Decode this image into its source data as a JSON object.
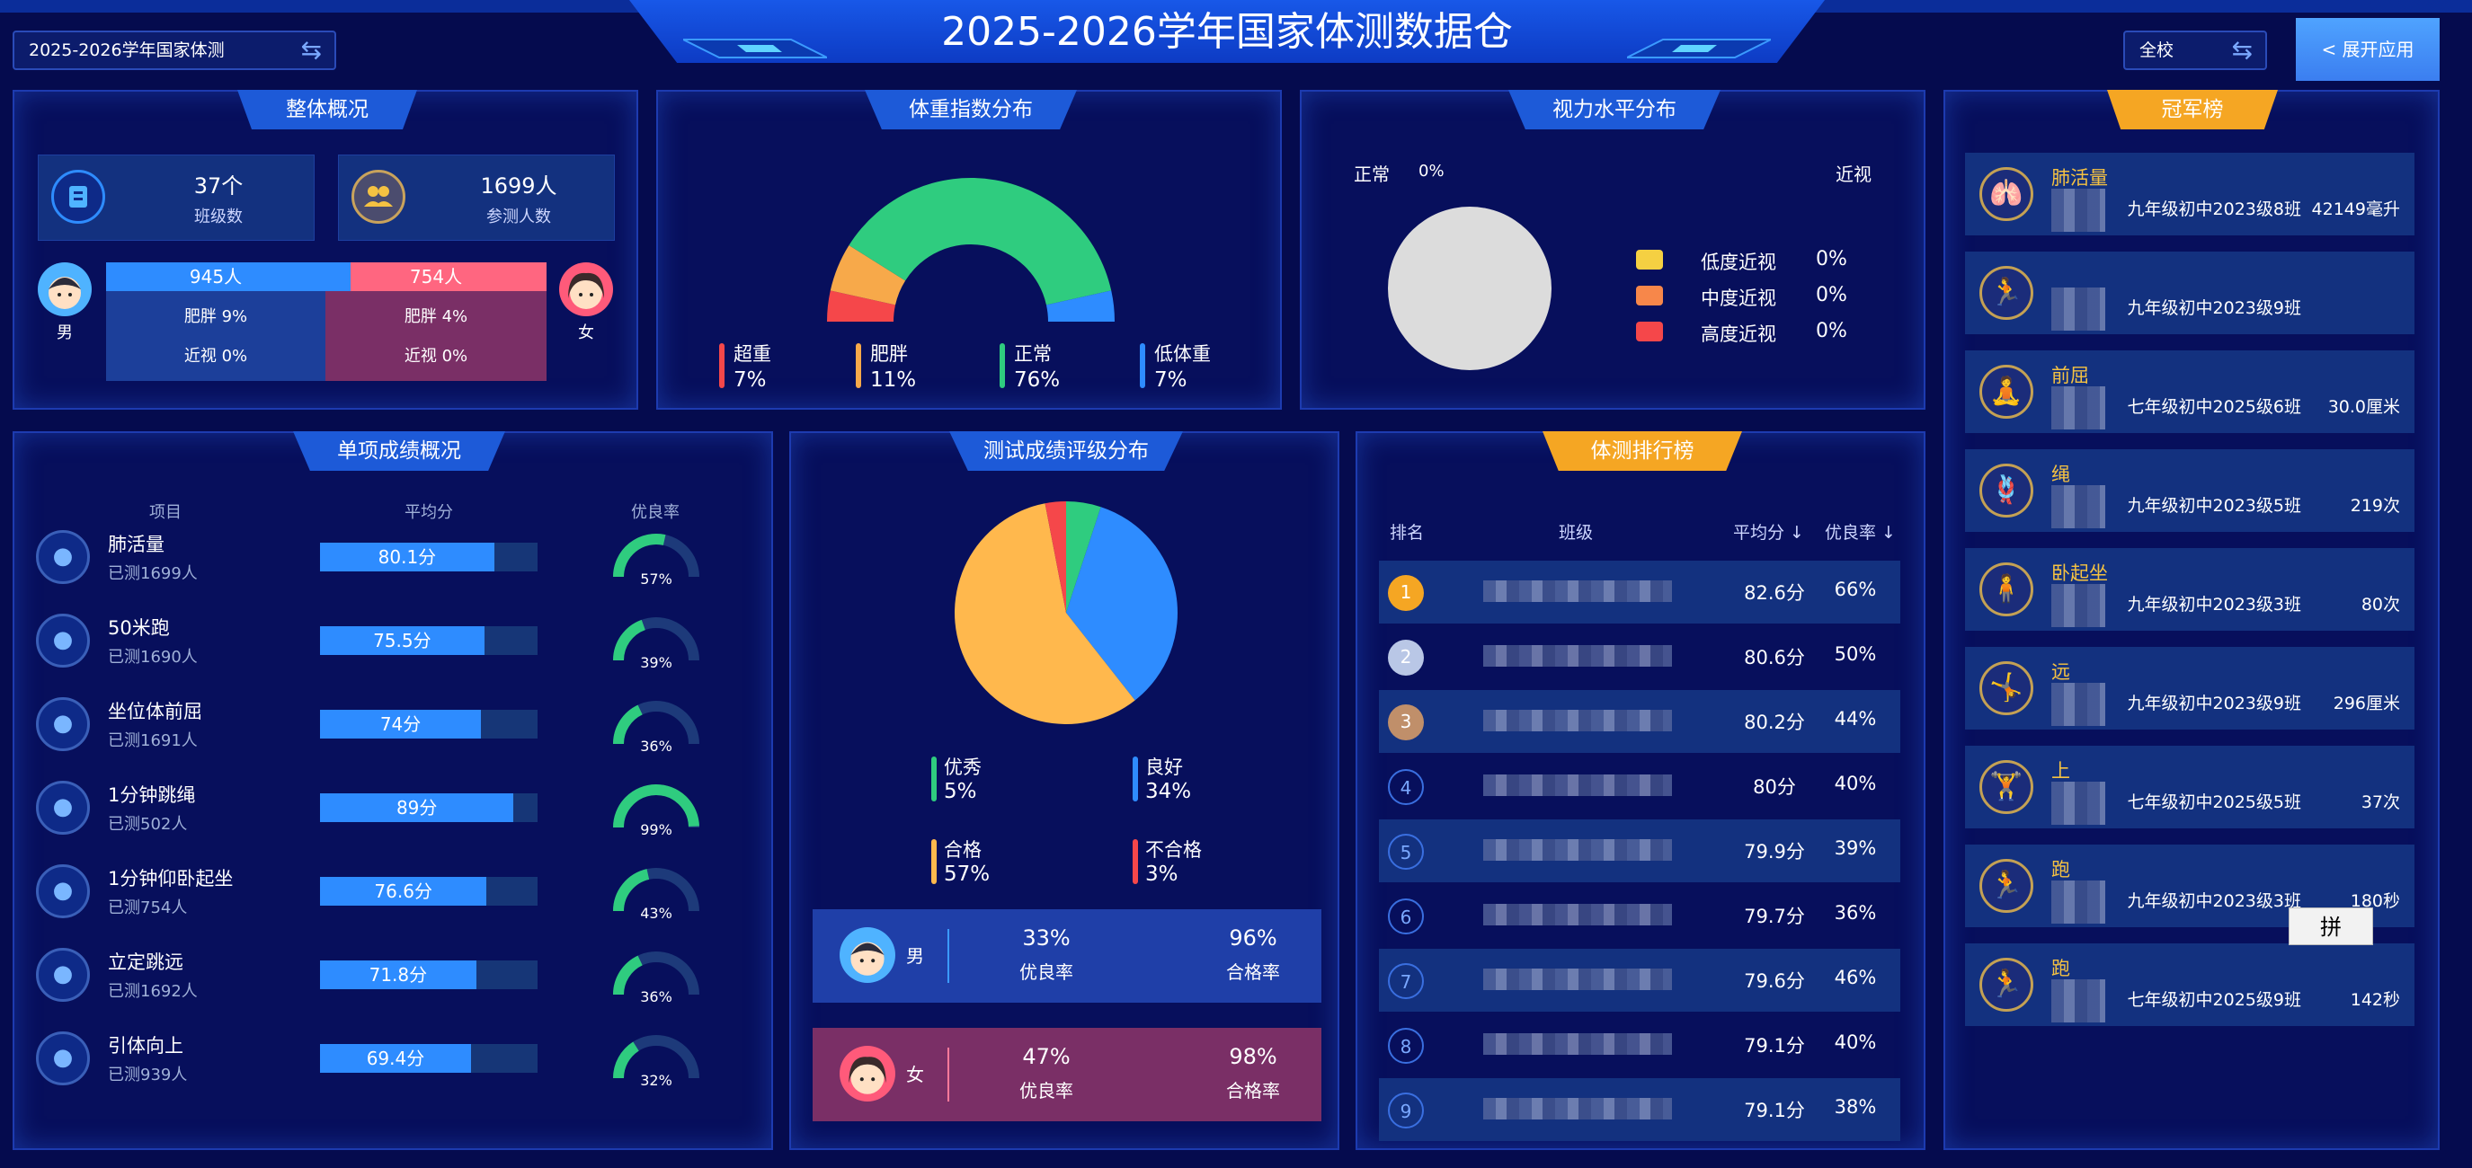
{
  "header": {
    "title": "2025-2026学年国家体测数据仓",
    "left_select": "2025-2026学年国家体测",
    "right_select": "全校",
    "expand_button": "< 展开应用"
  },
  "overview": {
    "title": "整体概况",
    "class_count": "37个",
    "class_count_label": "班级数",
    "participants": "1699人",
    "participants_label": "参测人数",
    "male": {
      "label": "男",
      "count": "945人",
      "obese": "肥胖 9%",
      "myopia": "近视 0%"
    },
    "female": {
      "label": "女",
      "count": "754人",
      "obese": "肥胖 4%",
      "myopia": "近视 0%"
    },
    "male_share": 0.556
  },
  "bmi": {
    "title": "体重指数分布",
    "items": [
      {
        "name": "超重",
        "pct": "7%",
        "color": "#f5474a",
        "value": 7
      },
      {
        "name": "肥胖",
        "pct": "11%",
        "color": "#f7a94a",
        "value": 11
      },
      {
        "name": "正常",
        "pct": "76%",
        "color": "#2fcc7f",
        "value": 76
      },
      {
        "name": "低体重",
        "pct": "7%",
        "color": "#2e8cff",
        "value": 7
      }
    ]
  },
  "vision": {
    "title": "视力水平分布",
    "normal_label": "正常",
    "normal_pct": "0%",
    "myopia_label": "近视",
    "items": [
      {
        "name": "低度近视",
        "pct": "0%",
        "color": "#f5d042"
      },
      {
        "name": "中度近视",
        "pct": "0%",
        "color": "#f7874a"
      },
      {
        "name": "高度近视",
        "pct": "0%",
        "color": "#f5474a"
      }
    ]
  },
  "champions": {
    "title": "冠军榜",
    "items": [
      {
        "name": "肺活量",
        "cls": "九年级初中2023级8班",
        "val": "42149毫升",
        "icon": "lungs-icon",
        "glyph": "🫁"
      },
      {
        "name": "",
        "cls": "九年级初中2023级9班",
        "val": "",
        "icon": "runner-icon",
        "glyph": "🏃"
      },
      {
        "name": "前屈",
        "cls": "七年级初中2025级6班",
        "val": "30.0厘米",
        "icon": "sit-reach-icon",
        "glyph": "🧘"
      },
      {
        "name": "绳",
        "cls": "九年级初中2023级5班",
        "val": "219次",
        "icon": "rope-icon",
        "glyph": "🪢"
      },
      {
        "name": "卧起坐",
        "cls": "九年级初中2023级3班",
        "val": "80次",
        "icon": "situp-icon",
        "glyph": "🧍"
      },
      {
        "name": "远",
        "cls": "九年级初中2023级9班",
        "val": "296厘米",
        "icon": "jump-icon",
        "glyph": "🤸"
      },
      {
        "name": "上",
        "cls": "七年级初中2025级5班",
        "val": "37次",
        "icon": "pullup-icon",
        "glyph": "🏋"
      },
      {
        "name": "跑",
        "cls": "九年级初中2023级3班",
        "val": "180秒",
        "icon": "run-long-icon",
        "glyph": "🏃"
      },
      {
        "name": "跑",
        "cls": "七年级初中2025级9班",
        "val": "142秒",
        "icon": "run-short-icon",
        "glyph": "🏃"
      }
    ]
  },
  "singles": {
    "title": "单项成绩概况",
    "col_item": "项目",
    "col_avg": "平均分",
    "col_rate": "优良率",
    "rows": [
      {
        "name": "肺活量",
        "tested": "已测1699人",
        "avg": "80.1分",
        "avg_v": 80.1,
        "rate": "57%",
        "rate_v": 57,
        "icon": "lungs-icon"
      },
      {
        "name": "50米跑",
        "tested": "已测1690人",
        "avg": "75.5分",
        "avg_v": 75.5,
        "rate": "39%",
        "rate_v": 39,
        "icon": "sprint-icon"
      },
      {
        "name": "坐位体前屈",
        "tested": "已测1691人",
        "avg": "74分",
        "avg_v": 74,
        "rate": "36%",
        "rate_v": 36,
        "icon": "sit-reach-icon"
      },
      {
        "name": "1分钟跳绳",
        "tested": "已测502人",
        "avg": "89分",
        "avg_v": 89,
        "rate": "99%",
        "rate_v": 99,
        "icon": "rope-icon"
      },
      {
        "name": "1分钟仰卧起坐",
        "tested": "已测754人",
        "avg": "76.6分",
        "avg_v": 76.6,
        "rate": "43%",
        "rate_v": 43,
        "icon": "situp-icon"
      },
      {
        "name": "立定跳远",
        "tested": "已测1692人",
        "avg": "71.8分",
        "avg_v": 71.8,
        "rate": "36%",
        "rate_v": 36,
        "icon": "jump-icon"
      },
      {
        "name": "引体向上",
        "tested": "已测939人",
        "avg": "69.4分",
        "avg_v": 69.4,
        "rate": "32%",
        "rate_v": 32,
        "icon": "pullup-icon"
      }
    ]
  },
  "grade_dist": {
    "title": "测试成绩评级分布",
    "items": [
      {
        "name": "优秀",
        "pct": "5%",
        "value": 5,
        "color": "#2fcc7f"
      },
      {
        "name": "良好",
        "pct": "34%",
        "value": 34,
        "color": "#2e8cff"
      },
      {
        "name": "合格",
        "pct": "57%",
        "value": 57,
        "color": "#ffb84d"
      },
      {
        "name": "不合格",
        "pct": "3%",
        "value": 3,
        "color": "#f5474a"
      }
    ],
    "male": {
      "label": "男",
      "good_rate": "33%",
      "good_label": "优良率",
      "pass_rate": "96%",
      "pass_label": "合格率"
    },
    "female": {
      "label": "女",
      "good_rate": "47%",
      "good_label": "优良率",
      "pass_rate": "98%",
      "pass_label": "合格率"
    }
  },
  "ranking": {
    "title": "体测排行榜",
    "col_rank": "排名",
    "col_class": "班级",
    "col_avg": "平均分",
    "col_rate": "优良率",
    "rows": [
      {
        "rank": "1",
        "avg": "82.6分",
        "rate": "66%"
      },
      {
        "rank": "2",
        "avg": "80.6分",
        "rate": "50%"
      },
      {
        "rank": "3",
        "avg": "80.2分",
        "rate": "44%"
      },
      {
        "rank": "4",
        "avg": "80分",
        "rate": "40%"
      },
      {
        "rank": "5",
        "avg": "79.9分",
        "rate": "39%"
      },
      {
        "rank": "6",
        "avg": "79.7分",
        "rate": "36%"
      },
      {
        "rank": "7",
        "avg": "79.6分",
        "rate": "46%"
      },
      {
        "rank": "8",
        "avg": "79.1分",
        "rate": "40%"
      },
      {
        "rank": "9",
        "avg": "79.1分",
        "rate": "38%"
      }
    ]
  },
  "ime_label": "拼",
  "chart_data": [
    {
      "type": "pie",
      "title": "体重指数分布",
      "categories": [
        "超重",
        "肥胖",
        "正常",
        "低体重"
      ],
      "values": [
        7,
        11,
        76,
        7
      ]
    },
    {
      "type": "pie",
      "title": "测试成绩评级分布",
      "categories": [
        "优秀",
        "良好",
        "合格",
        "不合格"
      ],
      "values": [
        5,
        34,
        57,
        3
      ]
    }
  ]
}
